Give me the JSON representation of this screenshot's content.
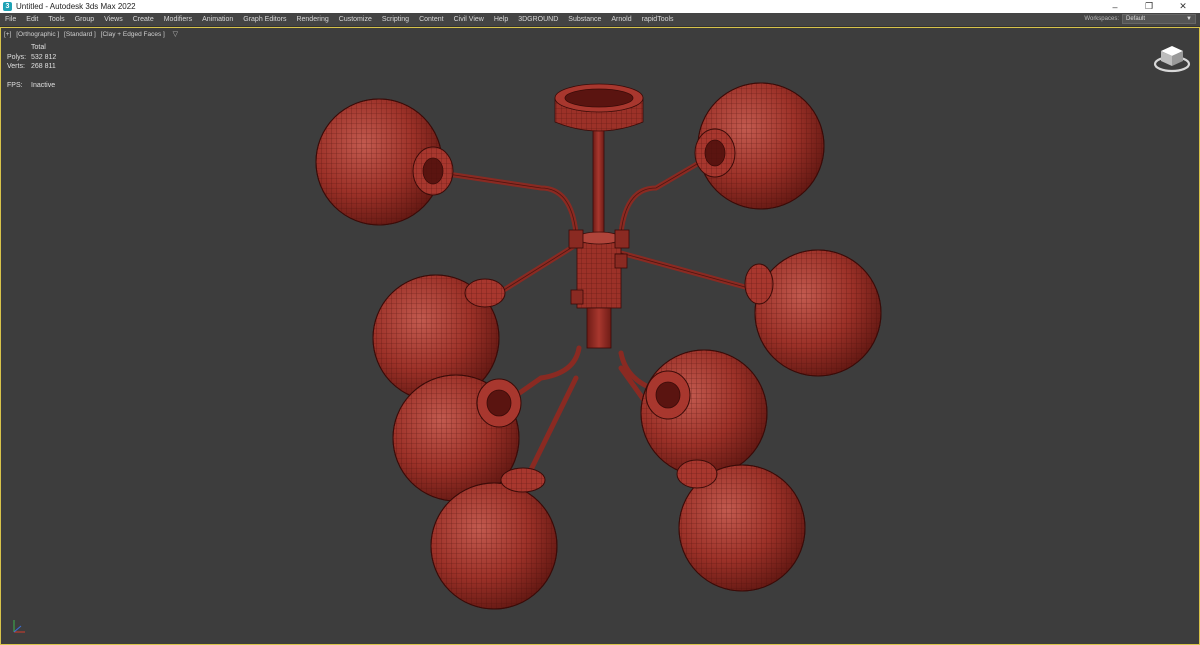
{
  "window": {
    "title": "Untitled - Autodesk 3ds Max 2022",
    "logo": "3",
    "controls": [
      "–",
      "❐",
      "✕"
    ]
  },
  "menu": {
    "items": [
      "File",
      "Edit",
      "Tools",
      "Group",
      "Views",
      "Create",
      "Modifiers",
      "Animation",
      "Graph Editors",
      "Rendering",
      "Customize",
      "Scripting",
      "Content",
      "Civil View",
      "Help",
      "3DGROUND",
      "Substance",
      "Arnold",
      "rapidTools"
    ],
    "workspaces_label": "Workspaces:",
    "workspaces_value": "Default"
  },
  "viewport": {
    "label_segments": [
      "[+]",
      "[Orthographic ]",
      "[Standard ]",
      "[Clay + Edged Faces ]"
    ],
    "stats": {
      "header": "Total",
      "polys_label": "Polys:",
      "polys_value": "532 812",
      "verts_label": "Verts:",
      "verts_value": "268 811",
      "fps_label": "FPS:",
      "fps_value": "Inactive"
    },
    "model_color": "#a8372e",
    "background": "#3d3d3d",
    "border_color": "#d8c34a",
    "icons": [
      "filter-icon",
      "viewcube-icon",
      "axis-tripod-icon"
    ]
  }
}
